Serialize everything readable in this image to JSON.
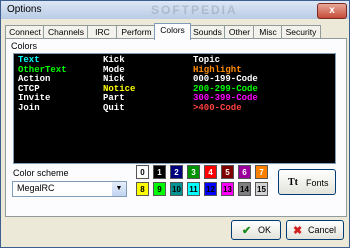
{
  "window": {
    "title": "Options",
    "close_glyph": "x",
    "watermark": "SOFTPEDIA"
  },
  "tabs": [
    {
      "label": "Connect"
    },
    {
      "label": "Channels"
    },
    {
      "label": "IRC"
    },
    {
      "label": "Perform"
    },
    {
      "label": "Colors",
      "active": true
    },
    {
      "label": "Sounds"
    },
    {
      "label": "Other"
    },
    {
      "label": "Misc"
    },
    {
      "label": "Security"
    }
  ],
  "colors_group": {
    "label": "Colors"
  },
  "preview": {
    "columns": [
      [
        {
          "text": "Text",
          "color": "#00ffff"
        },
        {
          "text": "OtherText",
          "color": "#00ff00"
        },
        {
          "text": "Action",
          "color": "#ffffff"
        },
        {
          "text": "CTCP",
          "color": "#ffffff"
        },
        {
          "text": "Invite",
          "color": "#ffffff"
        },
        {
          "text": "Join",
          "color": "#ffffff"
        }
      ],
      [
        {
          "text": "Kick",
          "color": "#ffffff"
        },
        {
          "text": "Mode",
          "color": "#ffffff"
        },
        {
          "text": "Nick",
          "color": "#ffffff"
        },
        {
          "text": "Notice",
          "color": "#ffff00"
        },
        {
          "text": "Part",
          "color": "#ffffff"
        },
        {
          "text": "Quit",
          "color": "#ffffff"
        }
      ],
      [
        {
          "text": "Topic",
          "color": "#ffffff"
        },
        {
          "text": "Highlight",
          "color": "#ff8c00"
        },
        {
          "text": "000-199-Code",
          "color": "#ffffff"
        },
        {
          "text": "200-299-Code",
          "color": "#00ff00"
        },
        {
          "text": "300-399-Code",
          "color": "#ff00ff"
        },
        {
          "text": ">400-Code",
          "color": "#ff4040"
        }
      ]
    ]
  },
  "color_scheme": {
    "label": "Color scheme",
    "value": "MegalRC",
    "arrow_glyph": "▼"
  },
  "palette": [
    {
      "num": "0",
      "bg": "#ffffff",
      "fg": "#000000"
    },
    {
      "num": "1",
      "bg": "#000000",
      "fg": "#ffffff"
    },
    {
      "num": "2",
      "bg": "#00007f",
      "fg": "#ffffff"
    },
    {
      "num": "3",
      "bg": "#009300",
      "fg": "#ffffff"
    },
    {
      "num": "4",
      "bg": "#ff0000",
      "fg": "#ffffff"
    },
    {
      "num": "5",
      "bg": "#7f0000",
      "fg": "#ffffff"
    },
    {
      "num": "6",
      "bg": "#9c009c",
      "fg": "#ffffff"
    },
    {
      "num": "7",
      "bg": "#fc7f00",
      "fg": "#ffffff"
    },
    {
      "num": "8",
      "bg": "#ffff00",
      "fg": "#000000"
    },
    {
      "num": "9",
      "bg": "#00fc00",
      "fg": "#000000"
    },
    {
      "num": "10",
      "bg": "#009393",
      "fg": "#000000"
    },
    {
      "num": "11",
      "bg": "#00ffff",
      "fg": "#000000"
    },
    {
      "num": "12",
      "bg": "#0000fc",
      "fg": "#000000"
    },
    {
      "num": "13",
      "bg": "#ff00ff",
      "fg": "#000000"
    },
    {
      "num": "14",
      "bg": "#7f7f7f",
      "fg": "#000000"
    },
    {
      "num": "15",
      "bg": "#d2d2d2",
      "fg": "#000000"
    }
  ],
  "fonts_button": {
    "label": "Fonts",
    "icon": "font-icon",
    "icon_glyph": "Tt"
  },
  "ok_button": {
    "label": "OK",
    "icon": "check-icon",
    "icon_glyph": "✔",
    "icon_color": "#1a8a1a"
  },
  "cancel_button": {
    "label": "Cancel",
    "icon": "cross-icon",
    "icon_glyph": "✖",
    "icon_color": "#d02020"
  }
}
